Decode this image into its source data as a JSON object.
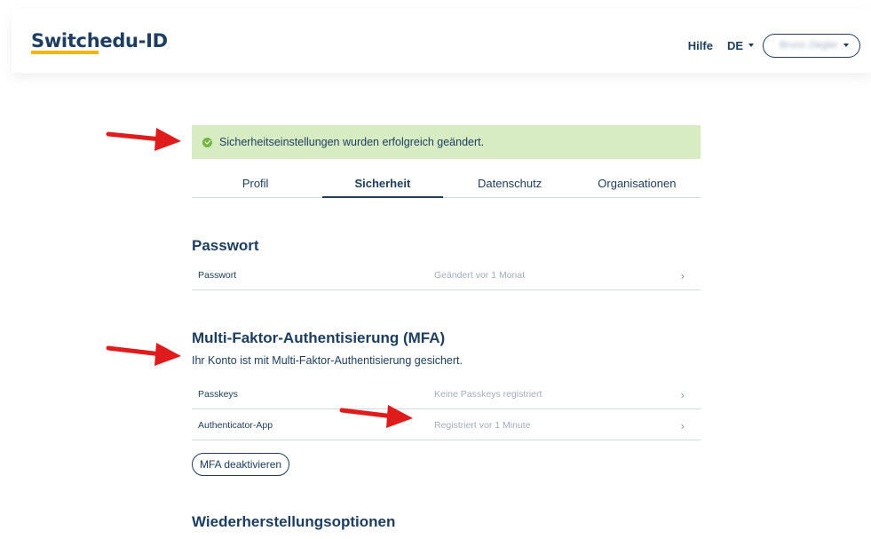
{
  "header": {
    "logo_part1": "Switch",
    "logo_part2": "edu-ID",
    "help": "Hilfe",
    "language": "DE",
    "user_name": "Bruno Ziegler"
  },
  "alert": {
    "message": "Sicherheitseinstellungen wurden erfolgreich geändert."
  },
  "tabs": [
    {
      "label": "Profil",
      "active": false
    },
    {
      "label": "Sicherheit",
      "active": true
    },
    {
      "label": "Datenschutz",
      "active": false
    },
    {
      "label": "Organisationen",
      "active": false
    }
  ],
  "password_section": {
    "title": "Passwort",
    "rows": [
      {
        "label": "Passwort",
        "value": "Geändert vor 1 Monat"
      }
    ]
  },
  "mfa_section": {
    "title": "Multi-Faktor-Authentisierung (MFA)",
    "description": "Ihr Konto ist mit Multi-Faktor-Authentisierung gesichert.",
    "rows": [
      {
        "label": "Passkeys",
        "value": "Keine Passkeys registriert"
      },
      {
        "label": "Authenticator-App",
        "value": "Registriert vor 1 Minute"
      }
    ],
    "disable_button": "MFA deaktivieren"
  },
  "recovery_section": {
    "title": "Wiederherstellungsoptionen"
  },
  "icons": {
    "chevron": "›",
    "success": "check-circle",
    "dropdown": "caret-down"
  },
  "colors": {
    "primary": "#1d3e60",
    "accent": "#f3b515",
    "alert_bg": "#d8ecc4",
    "success": "#74b642",
    "annotation": "#e01b1b"
  }
}
